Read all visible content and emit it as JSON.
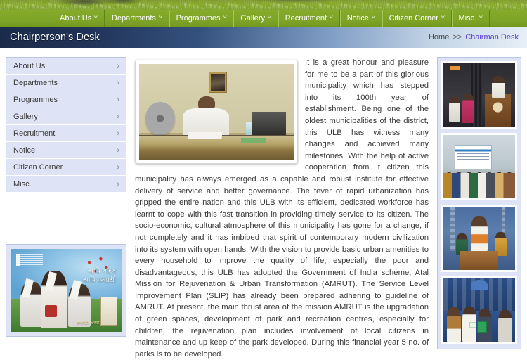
{
  "topnav": {
    "items": [
      {
        "label": "About Us",
        "caret": "chevron-down-icon"
      },
      {
        "label": "Departments",
        "caret": "chevron-down-icon"
      },
      {
        "label": "Programmes",
        "caret": "chevron-down-icon"
      },
      {
        "label": "Gallery",
        "caret": "chevron-down-icon"
      },
      {
        "label": "Recruitment",
        "caret": "chevron-down-icon"
      },
      {
        "label": "Notice",
        "caret": "chevron-down-icon"
      },
      {
        "label": "Citizen Corner",
        "caret": "chevron-down-icon"
      },
      {
        "label": "Misc.",
        "caret": "chevron-down-icon"
      }
    ],
    "caret_glyph": "˅"
  },
  "titlebar": {
    "title": "Chairperson's Desk",
    "breadcrumb": {
      "home": "Home",
      "separator": ">>",
      "current": "Chairman Desk"
    }
  },
  "sidebar": {
    "items": [
      {
        "label": "About Us",
        "chevron": "chevron-right-icon"
      },
      {
        "label": "Departments",
        "chevron": "chevron-right-icon"
      },
      {
        "label": "Programmes",
        "chevron": "chevron-right-icon"
      },
      {
        "label": "Gallery",
        "chevron": "chevron-right-icon"
      },
      {
        "label": "Recruitment",
        "chevron": "chevron-right-icon"
      },
      {
        "label": "Notice",
        "chevron": "chevron-right-icon"
      },
      {
        "label": "Citizen Corner",
        "chevron": "chevron-right-icon"
      },
      {
        "label": "Misc.",
        "chevron": "chevron-right-icon"
      }
    ],
    "chevron_glyph": "›",
    "banner": {
      "headline_line1": "আমি সাহস",
      "headline_line2": "আমি কন্যাশ্রী",
      "caption": "কন্যাশ্রী প্রকল্প"
    }
  },
  "main": {
    "photo_alt": "chairperson-at-desk-photo",
    "paragraph": "It is a great honour and pleasure for me to be a part of this glorious municipality which has stepped into its 100th year of establishment. Being one of the oldest municipalities of the district, this ULB has witness many changes and achieved many milestones. With the help of active cooperation from it citizen this municipality has always emerged as a capable and robust institute for effective delivery of service and better governance. The fever of rapid urbanization has gripped the entire nation and this ULB with its efficient, dedicated workforce has learnt to cope with this fast transition in providing timely service to its citizen. The socio-economic, cultural atmosphere of this municipality has gone for a change, if not completely and it has imbibed that spirit of contemporary modern civilization into its system with open hands. With the vision to provide basic urban amenities to every household to improve the quality of life, especially the poor and disadvantageous, this ULB has adopted the Government of India scheme, Atal Mission for Rejuvenation & Urban Transformation (AMRUT). The Service Level Improvement Plan (SLIP) has already been prepared adhering to guideline of AMRUT. At present, the main thrust area of the mission AMRUT is the upgradation of green spaces, development of park and recreation centres, especially for children, the rejuvenation plan includes involvement of local citizens in maintenance and up keep of the park developed. During this financial year 5 no. of parks is to be developed."
  },
  "right_sidebar": {
    "thumbnails": [
      {
        "name": "gallery-thumb-stage-speech"
      },
      {
        "name": "gallery-thumb-health-camp"
      },
      {
        "name": "gallery-thumb-outdoor-address"
      },
      {
        "name": "gallery-thumb-distribution-event"
      }
    ]
  },
  "colors": {
    "nav_green": "#7ea428",
    "title_navy": "#1b2b4a",
    "sidebar_lavender": "#dee3f5",
    "link_purple": "#5a3fd6",
    "text_gray": "#3a3a3a"
  }
}
